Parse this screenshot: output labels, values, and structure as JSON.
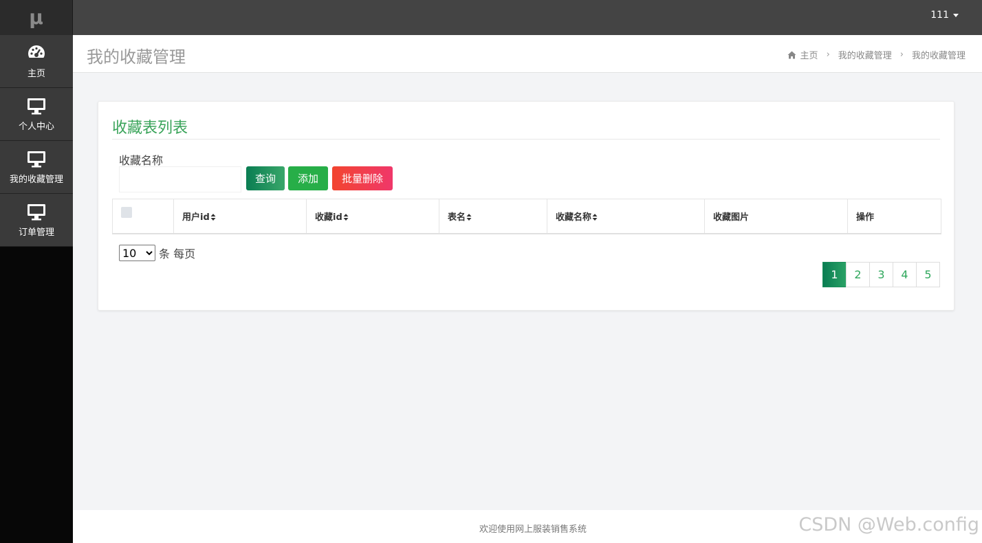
{
  "app": {
    "logo": "μ"
  },
  "sidebar": {
    "items": [
      {
        "label": "主页",
        "icon": "dashboard-icon"
      },
      {
        "label": "个人中心",
        "icon": "monitor-icon"
      },
      {
        "label": "我的收藏管理",
        "icon": "monitor-icon"
      },
      {
        "label": "订单管理",
        "icon": "monitor-icon"
      }
    ]
  },
  "topbar": {
    "user": "111"
  },
  "header": {
    "title": "我的收藏管理",
    "breadcrumb": {
      "home": "主页",
      "level1": "我的收藏管理",
      "level2": "我的收藏管理"
    }
  },
  "card": {
    "title": "收藏表列表",
    "search": {
      "label": "收藏名称",
      "value": "",
      "placeholder": ""
    },
    "buttons": {
      "query": "查询",
      "add": "添加",
      "batch_delete": "批量删除"
    },
    "table": {
      "columns": [
        "用户id",
        "收藏id",
        "表名",
        "收藏名称",
        "收藏图片",
        "操作"
      ],
      "rows": []
    },
    "page_size": {
      "selected": "10",
      "suffix": "条 每页"
    },
    "pagination": {
      "pages": [
        "1",
        "2",
        "3",
        "4",
        "5"
      ],
      "current": "1"
    }
  },
  "footer": {
    "text": "欢迎使用网上服装销售系统"
  },
  "watermark": "CSDN @Web.config",
  "colors": {
    "accent_green": "#3aa45a",
    "danger_red": "#f2452f",
    "topbar": "#444444",
    "sidebar": "#3a3a3a"
  }
}
